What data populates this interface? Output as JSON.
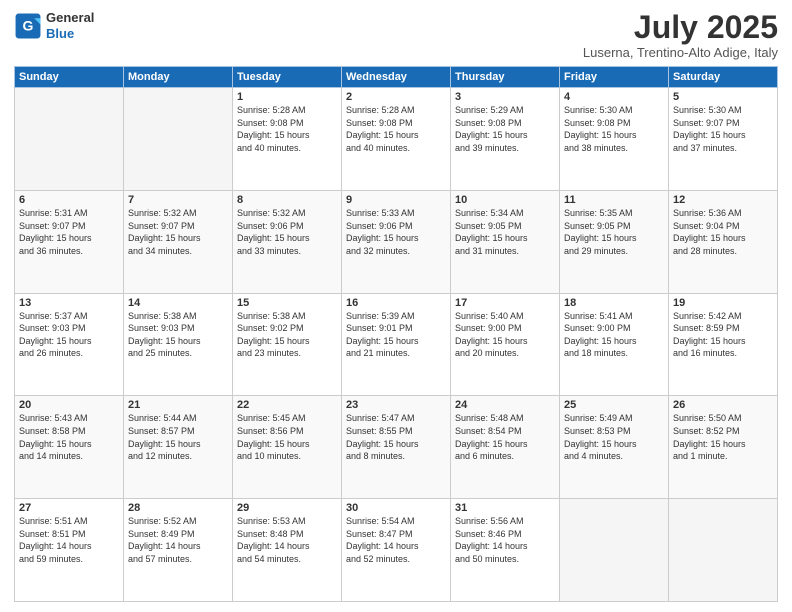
{
  "header": {
    "logo_line1": "General",
    "logo_line2": "Blue",
    "title": "July 2025",
    "location": "Luserna, Trentino-Alto Adige, Italy"
  },
  "days_of_week": [
    "Sunday",
    "Monday",
    "Tuesday",
    "Wednesday",
    "Thursday",
    "Friday",
    "Saturday"
  ],
  "weeks": [
    [
      {
        "day": "",
        "info": ""
      },
      {
        "day": "",
        "info": ""
      },
      {
        "day": "1",
        "info": "Sunrise: 5:28 AM\nSunset: 9:08 PM\nDaylight: 15 hours\nand 40 minutes."
      },
      {
        "day": "2",
        "info": "Sunrise: 5:28 AM\nSunset: 9:08 PM\nDaylight: 15 hours\nand 40 minutes."
      },
      {
        "day": "3",
        "info": "Sunrise: 5:29 AM\nSunset: 9:08 PM\nDaylight: 15 hours\nand 39 minutes."
      },
      {
        "day": "4",
        "info": "Sunrise: 5:30 AM\nSunset: 9:08 PM\nDaylight: 15 hours\nand 38 minutes."
      },
      {
        "day": "5",
        "info": "Sunrise: 5:30 AM\nSunset: 9:07 PM\nDaylight: 15 hours\nand 37 minutes."
      }
    ],
    [
      {
        "day": "6",
        "info": "Sunrise: 5:31 AM\nSunset: 9:07 PM\nDaylight: 15 hours\nand 36 minutes."
      },
      {
        "day": "7",
        "info": "Sunrise: 5:32 AM\nSunset: 9:07 PM\nDaylight: 15 hours\nand 34 minutes."
      },
      {
        "day": "8",
        "info": "Sunrise: 5:32 AM\nSunset: 9:06 PM\nDaylight: 15 hours\nand 33 minutes."
      },
      {
        "day": "9",
        "info": "Sunrise: 5:33 AM\nSunset: 9:06 PM\nDaylight: 15 hours\nand 32 minutes."
      },
      {
        "day": "10",
        "info": "Sunrise: 5:34 AM\nSunset: 9:05 PM\nDaylight: 15 hours\nand 31 minutes."
      },
      {
        "day": "11",
        "info": "Sunrise: 5:35 AM\nSunset: 9:05 PM\nDaylight: 15 hours\nand 29 minutes."
      },
      {
        "day": "12",
        "info": "Sunrise: 5:36 AM\nSunset: 9:04 PM\nDaylight: 15 hours\nand 28 minutes."
      }
    ],
    [
      {
        "day": "13",
        "info": "Sunrise: 5:37 AM\nSunset: 9:03 PM\nDaylight: 15 hours\nand 26 minutes."
      },
      {
        "day": "14",
        "info": "Sunrise: 5:38 AM\nSunset: 9:03 PM\nDaylight: 15 hours\nand 25 minutes."
      },
      {
        "day": "15",
        "info": "Sunrise: 5:38 AM\nSunset: 9:02 PM\nDaylight: 15 hours\nand 23 minutes."
      },
      {
        "day": "16",
        "info": "Sunrise: 5:39 AM\nSunset: 9:01 PM\nDaylight: 15 hours\nand 21 minutes."
      },
      {
        "day": "17",
        "info": "Sunrise: 5:40 AM\nSunset: 9:00 PM\nDaylight: 15 hours\nand 20 minutes."
      },
      {
        "day": "18",
        "info": "Sunrise: 5:41 AM\nSunset: 9:00 PM\nDaylight: 15 hours\nand 18 minutes."
      },
      {
        "day": "19",
        "info": "Sunrise: 5:42 AM\nSunset: 8:59 PM\nDaylight: 15 hours\nand 16 minutes."
      }
    ],
    [
      {
        "day": "20",
        "info": "Sunrise: 5:43 AM\nSunset: 8:58 PM\nDaylight: 15 hours\nand 14 minutes."
      },
      {
        "day": "21",
        "info": "Sunrise: 5:44 AM\nSunset: 8:57 PM\nDaylight: 15 hours\nand 12 minutes."
      },
      {
        "day": "22",
        "info": "Sunrise: 5:45 AM\nSunset: 8:56 PM\nDaylight: 15 hours\nand 10 minutes."
      },
      {
        "day": "23",
        "info": "Sunrise: 5:47 AM\nSunset: 8:55 PM\nDaylight: 15 hours\nand 8 minutes."
      },
      {
        "day": "24",
        "info": "Sunrise: 5:48 AM\nSunset: 8:54 PM\nDaylight: 15 hours\nand 6 minutes."
      },
      {
        "day": "25",
        "info": "Sunrise: 5:49 AM\nSunset: 8:53 PM\nDaylight: 15 hours\nand 4 minutes."
      },
      {
        "day": "26",
        "info": "Sunrise: 5:50 AM\nSunset: 8:52 PM\nDaylight: 15 hours\nand 1 minute."
      }
    ],
    [
      {
        "day": "27",
        "info": "Sunrise: 5:51 AM\nSunset: 8:51 PM\nDaylight: 14 hours\nand 59 minutes."
      },
      {
        "day": "28",
        "info": "Sunrise: 5:52 AM\nSunset: 8:49 PM\nDaylight: 14 hours\nand 57 minutes."
      },
      {
        "day": "29",
        "info": "Sunrise: 5:53 AM\nSunset: 8:48 PM\nDaylight: 14 hours\nand 54 minutes."
      },
      {
        "day": "30",
        "info": "Sunrise: 5:54 AM\nSunset: 8:47 PM\nDaylight: 14 hours\nand 52 minutes."
      },
      {
        "day": "31",
        "info": "Sunrise: 5:56 AM\nSunset: 8:46 PM\nDaylight: 14 hours\nand 50 minutes."
      },
      {
        "day": "",
        "info": ""
      },
      {
        "day": "",
        "info": ""
      }
    ]
  ]
}
